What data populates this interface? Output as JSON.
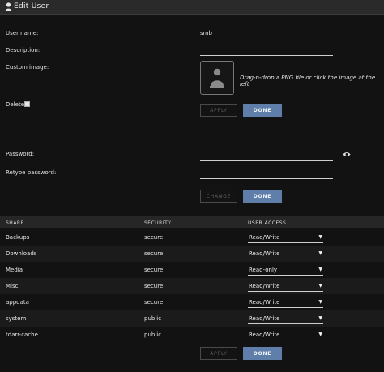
{
  "header": {
    "title": "Edit User",
    "icon": "user-icon"
  },
  "form": {
    "username_label": "User name:",
    "username_value": "smb",
    "description_label": "Description:",
    "description_value": "",
    "custom_image_label": "Custom image:",
    "image_hint": "Drag-n-drop a PNG file or click the image at the left.",
    "delete_label": "Delete",
    "apply_label": "APPLY",
    "done_label": "DONE"
  },
  "password": {
    "password_label": "Password:",
    "retype_label": "Retype password:",
    "change_label": "CHANGE",
    "done_label": "DONE"
  },
  "shares": {
    "columns": [
      "SHARE",
      "SECURITY",
      "USER ACCESS"
    ],
    "rows": [
      {
        "share": "Backups",
        "security": "secure",
        "access": "Read/Write"
      },
      {
        "share": "Downloads",
        "security": "secure",
        "access": "Read/Write"
      },
      {
        "share": "Media",
        "security": "secure",
        "access": "Read-only"
      },
      {
        "share": "Misc",
        "security": "secure",
        "access": "Read/Write"
      },
      {
        "share": "appdata",
        "security": "secure",
        "access": "Read/Write"
      },
      {
        "share": "system",
        "security": "public",
        "access": "Read/Write"
      },
      {
        "share": "tdarr-cache",
        "security": "public",
        "access": "Read/Write"
      }
    ],
    "apply_label": "APPLY",
    "done_label": "DONE"
  },
  "colors": {
    "accent": "#5f7ea9",
    "background": "#121212"
  }
}
